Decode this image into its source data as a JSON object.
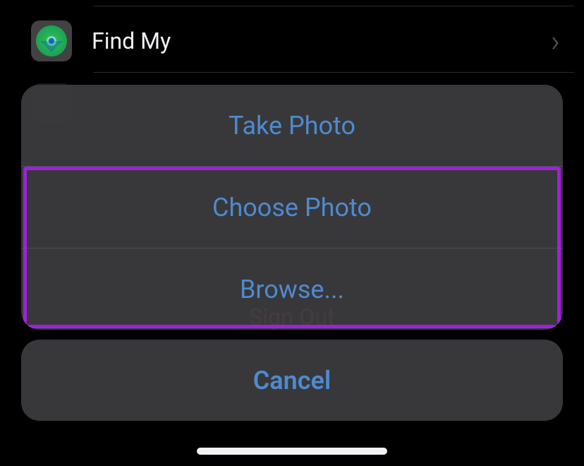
{
  "settings": {
    "rows": {
      "findMy": {
        "label": "Find My"
      }
    },
    "signOut": "Sign Out"
  },
  "actionSheet": {
    "takePhoto": "Take Photo",
    "choosePhoto": "Choose Photo",
    "browse": "Browse...",
    "cancel": "Cancel"
  }
}
